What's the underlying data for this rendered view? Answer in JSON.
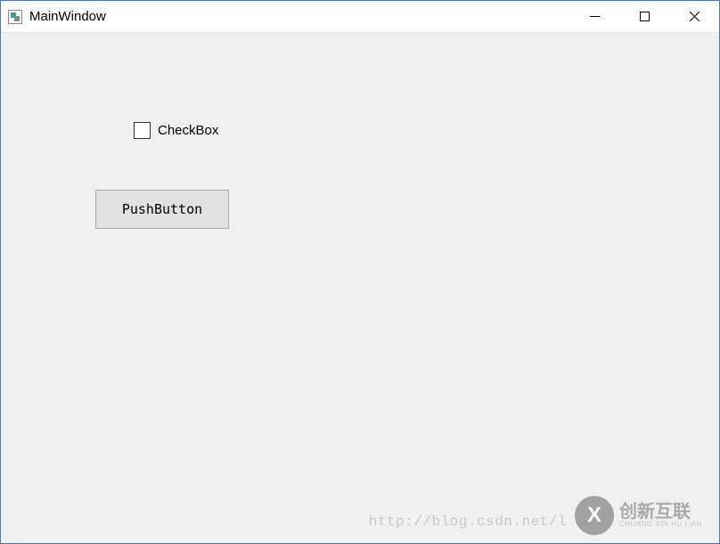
{
  "window": {
    "title": "MainWindow"
  },
  "controls": {
    "checkbox_label": "CheckBox",
    "pushbutton_label": "PushButton"
  },
  "watermark": {
    "url_text": "http://blog.csdn.net/l",
    "logo_letter": "X",
    "logo_main": "创新互联",
    "logo_sub": "CHUANG XIN HU LIAN"
  }
}
